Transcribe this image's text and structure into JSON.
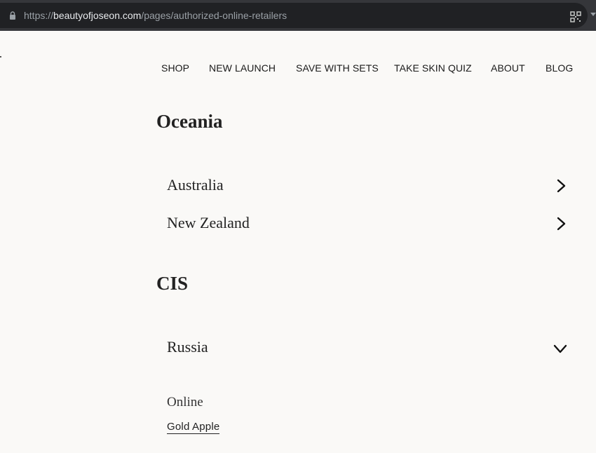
{
  "browser": {
    "url_scheme": "https://",
    "url_host": "beautyofjoseon.com",
    "url_path": "/pages/authorized-online-retailers",
    "icons": [
      "lock-icon",
      "qr-code-icon",
      "menu-caret-icon"
    ]
  },
  "nav": {
    "items": [
      "SHOP",
      "NEW LAUNCH",
      "SAVE WITH SETS",
      "TAKE SKIN QUIZ",
      "ABOUT",
      "BLOG"
    ]
  },
  "content": {
    "regions": [
      {
        "name": "Oceania",
        "countries": [
          {
            "name": "Australia",
            "state": "collapsed",
            "icon": "chevron-right-icon"
          },
          {
            "name": "New Zealand",
            "state": "collapsed",
            "icon": "chevron-right-icon"
          }
        ]
      },
      {
        "name": "CIS",
        "countries": [
          {
            "name": "Russia",
            "state": "expanded",
            "icon": "chevron-down-icon",
            "sections": [
              {
                "label": "Online",
                "links": [
                  "Gold Apple"
                ]
              }
            ]
          }
        ]
      }
    ]
  },
  "colors": {
    "page_bg": "#faf9f7",
    "text": "#222222",
    "chrome_bg": "#35363a",
    "urlbar_bg": "#202124"
  }
}
